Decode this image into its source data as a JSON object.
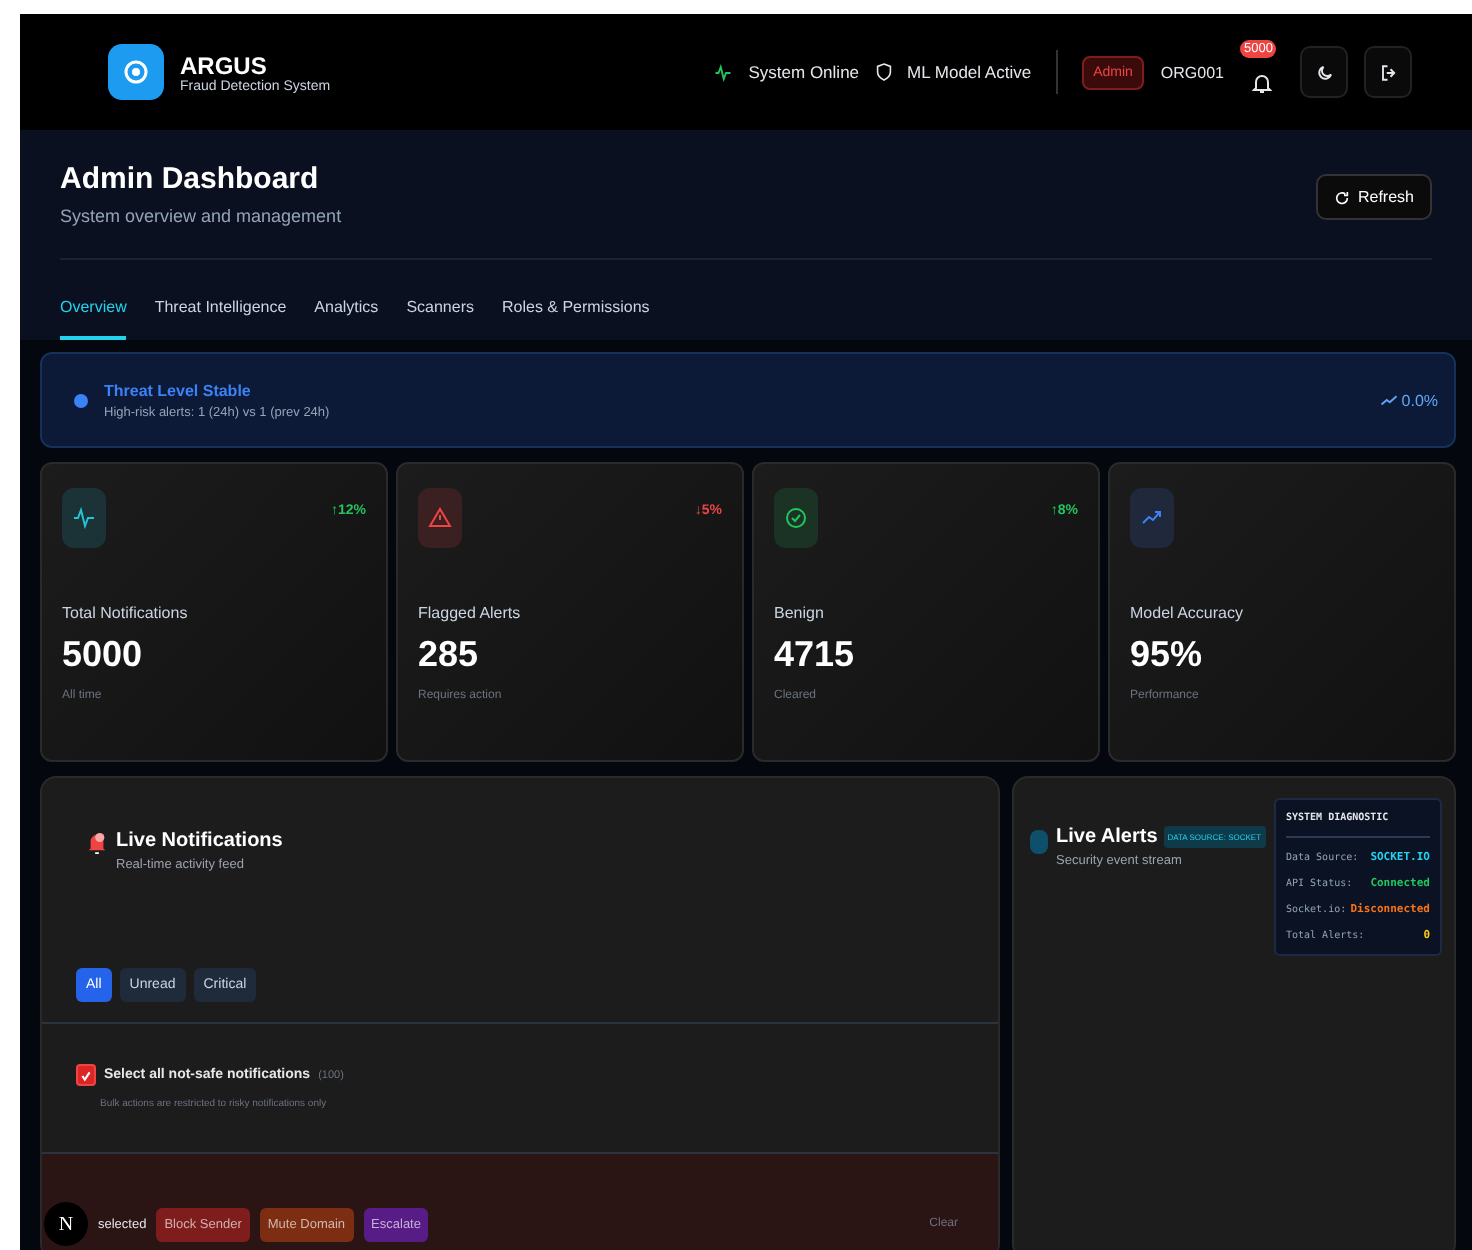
{
  "header": {
    "app_name": "ARGUS",
    "app_subtitle": "Fraud Detection System",
    "system_status": "System Online",
    "model_status": "ML Model Active",
    "role_badge": "Admin",
    "org": "ORG001",
    "notification_count": "5000"
  },
  "page": {
    "title": "Admin Dashboard",
    "subtitle": "System overview and management",
    "refresh_label": "Refresh"
  },
  "tabs": [
    {
      "label": "Overview",
      "selected": true
    },
    {
      "label": "Threat Intelligence",
      "selected": false
    },
    {
      "label": "Analytics",
      "selected": false
    },
    {
      "label": "Scanners",
      "selected": false
    },
    {
      "label": "Roles & Permissions",
      "selected": false
    }
  ],
  "threat_banner": {
    "title": "Threat Level Stable",
    "detail": "High-risk alerts: 1 (24h) vs 1 (prev 24h)",
    "change": "0.0%"
  },
  "stats": [
    {
      "kind": "activity",
      "color": "#22c5d5",
      "label": "Total Notifications",
      "value": "5000",
      "note": "All time",
      "trend": {
        "text": "↑12%",
        "color": "#22c55e"
      }
    },
    {
      "kind": "warning",
      "color": "#ef4444",
      "label": "Flagged Alerts",
      "value": "285",
      "note": "Requires action",
      "trend": {
        "text": "↓5%",
        "color": "#ef4444"
      }
    },
    {
      "kind": "check",
      "color": "#22c55e",
      "label": "Benign",
      "value": "4715",
      "note": "Cleared",
      "trend": {
        "text": "↑8%",
        "color": "#22c55e"
      }
    },
    {
      "kind": "trend",
      "color": "#3b82f6",
      "label": "Model Accuracy",
      "value": "95%",
      "note": "Performance"
    }
  ],
  "live_notifications": {
    "title": "Live Notifications",
    "subtitle": "Real-time activity feed",
    "filters": [
      {
        "label": "All",
        "selected": true
      },
      {
        "label": "Unread",
        "selected": false
      },
      {
        "label": "Critical",
        "selected": false
      }
    ],
    "select_all": {
      "label": "Select all not-safe notifications",
      "count": "(100)",
      "checked": true,
      "hint": "Bulk actions are restricted to risky notifications only"
    },
    "bulk_bar": {
      "selected_text": "selected",
      "dev_badge": "N",
      "actions": [
        {
          "label": "Block Sender",
          "color": "#7f1d1d"
        },
        {
          "label": "Mute Domain",
          "color": "#7c2d12"
        },
        {
          "label": "Escalate",
          "color": "#581c87"
        }
      ],
      "clear_label": "Clear"
    }
  },
  "live_alerts": {
    "title": "Live Alerts",
    "source_badge": "DATA SOURCE: SOCKET",
    "subtitle": "Security event stream"
  },
  "diagnostic": {
    "title": "SYSTEM DIAGNOSTIC",
    "rows": [
      {
        "label": "Data Source:",
        "value": "SOCKET.IO",
        "color": "#22d3ee"
      },
      {
        "label": "API Status:",
        "value": "Connected",
        "color": "#22c55e"
      },
      {
        "label": "Socket.io:",
        "value": "Disconnected",
        "color": "#f97316"
      },
      {
        "label": "Total Alerts:",
        "value": "0",
        "color": "#facc15"
      }
    ]
  }
}
